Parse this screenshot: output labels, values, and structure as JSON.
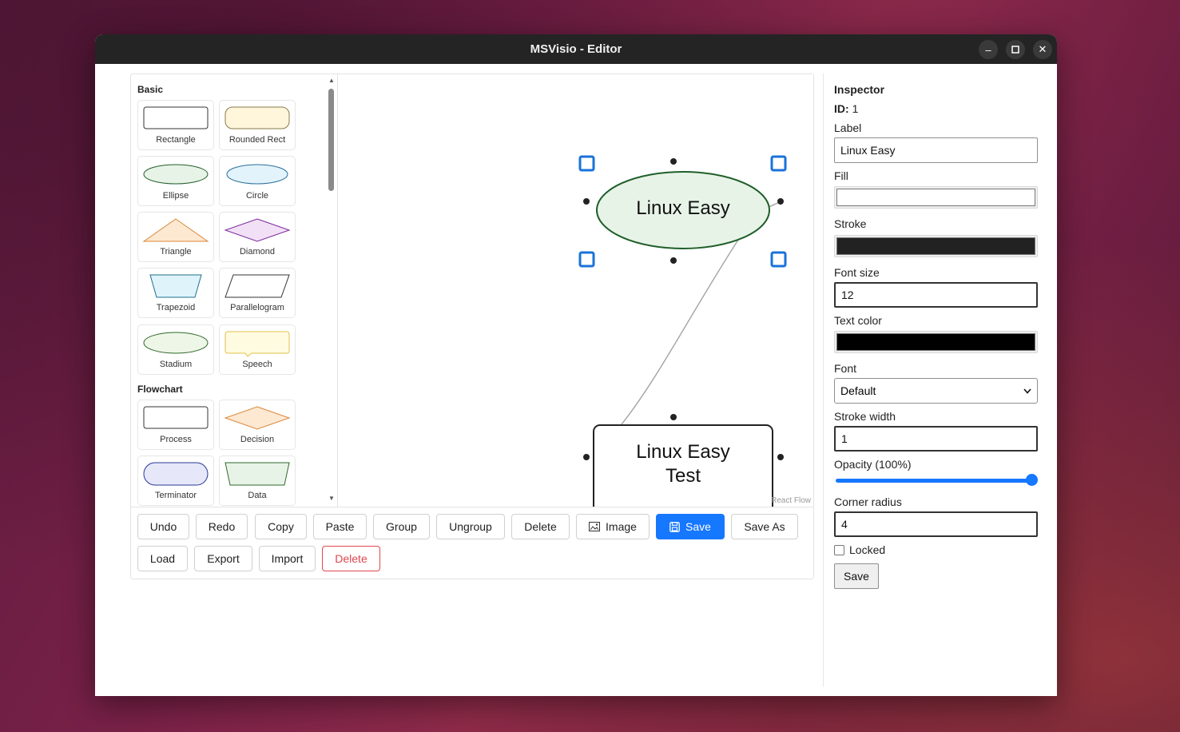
{
  "window": {
    "title": "MSVisio - Editor"
  },
  "palette": {
    "sections": [
      {
        "title": "Basic",
        "items": [
          "Rectangle",
          "Rounded Rect",
          "Ellipse",
          "Circle",
          "Triangle",
          "Diamond",
          "Trapezoid",
          "Parallelogram",
          "Stadium",
          "Speech"
        ]
      },
      {
        "title": "Flowchart",
        "items": [
          "Process",
          "Decision",
          "Terminator",
          "Data"
        ]
      }
    ]
  },
  "canvas": {
    "nodes": [
      {
        "id": "1",
        "label": "Linux Easy",
        "shape": "ellipse",
        "fill": "#e8f3e8",
        "stroke": "#1f5f2a",
        "selected": true
      },
      {
        "id": "2",
        "label_line1": "Linux Easy",
        "label_line2": "Test",
        "shape": "rounded-rect",
        "fill": "#ffffff",
        "stroke": "#222222"
      }
    ],
    "attribution": "React Flow"
  },
  "toolbar": {
    "undo": "Undo",
    "redo": "Redo",
    "copy": "Copy",
    "paste": "Paste",
    "group": "Group",
    "ungroup": "Ungroup",
    "delete": "Delete",
    "image": "Image",
    "save": "Save",
    "save_as": "Save As",
    "load": "Load",
    "export": "Export",
    "import": "Import",
    "delete_all": "Delete"
  },
  "inspector": {
    "title": "Inspector",
    "id_label": "ID:",
    "id_value": "1",
    "label_label": "Label",
    "label_value": "Linux Easy",
    "fill_label": "Fill",
    "fill_color": "#ffffff",
    "stroke_label": "Stroke",
    "stroke_color": "#222222",
    "font_size_label": "Font size",
    "font_size_value": "12",
    "text_color_label": "Text color",
    "text_color": "#000000",
    "font_label": "Font",
    "font_value": "Default",
    "stroke_width_label": "Stroke width",
    "stroke_width_value": "1",
    "opacity_label": "Opacity (100%)",
    "opacity_value": 1.0,
    "corner_radius_label": "Corner radius",
    "corner_radius_value": "4",
    "locked_label": "Locked",
    "locked": false,
    "save_label": "Save"
  },
  "colors": {
    "accent": "#1677ff",
    "danger": "#e0464f",
    "titlebar": "#242424"
  }
}
